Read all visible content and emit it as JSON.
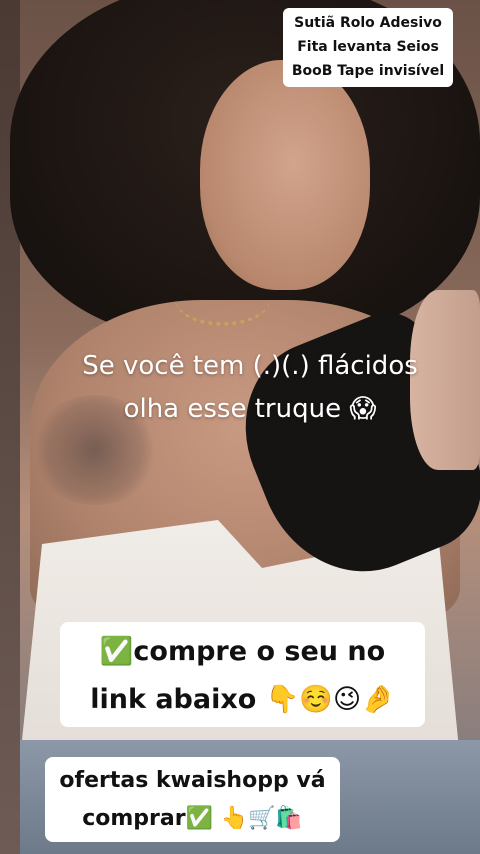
{
  "product_label": {
    "line1": "Sutiã Rolo Adesivo",
    "line2": "Fita levanta Seios",
    "line3": "BooB Tape invisível"
  },
  "caption": {
    "line1": "Se você tem (.)(.) flácidos",
    "line2": "olha esse truque 😱"
  },
  "cta": {
    "line1": "✅compre o seu no",
    "line2": "link abaixo 👇☺️😉🤌"
  },
  "offer": {
    "line1": "ofertas kwaishopp vá",
    "line2": "comprar✅ 👆🛒🛍️"
  },
  "colors": {
    "label_background": "#ffffff",
    "label_text": "#111111",
    "caption_text": "#ffffff",
    "tape": "#161313"
  }
}
